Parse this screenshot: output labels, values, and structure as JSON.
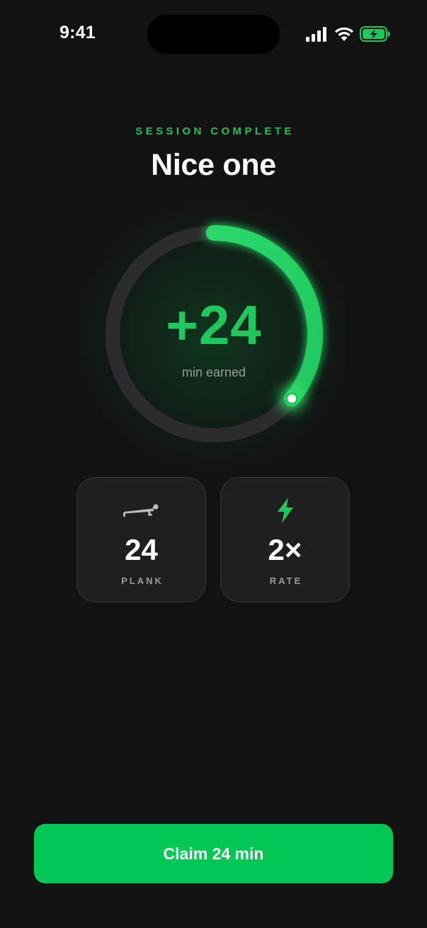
{
  "status_bar": {
    "time": "9:41"
  },
  "header": {
    "eyebrow": "SESSION COMPLETE",
    "title": "Nice one"
  },
  "ring": {
    "value": "+24",
    "caption": "min earned",
    "progress_fraction": 0.36
  },
  "stats": [
    {
      "icon": "plank-figure-icon",
      "value": "24",
      "label": "PLANK"
    },
    {
      "icon": "lightning-bolt-icon",
      "value": "2×",
      "label": "RATE"
    }
  ],
  "cta": {
    "label": "Claim 24 min"
  },
  "colors": {
    "background": "#121212",
    "accent": "#00c853",
    "accent_text": "#1fc75c",
    "card": "#1f1f1f",
    "track": "#2c2c2e"
  }
}
